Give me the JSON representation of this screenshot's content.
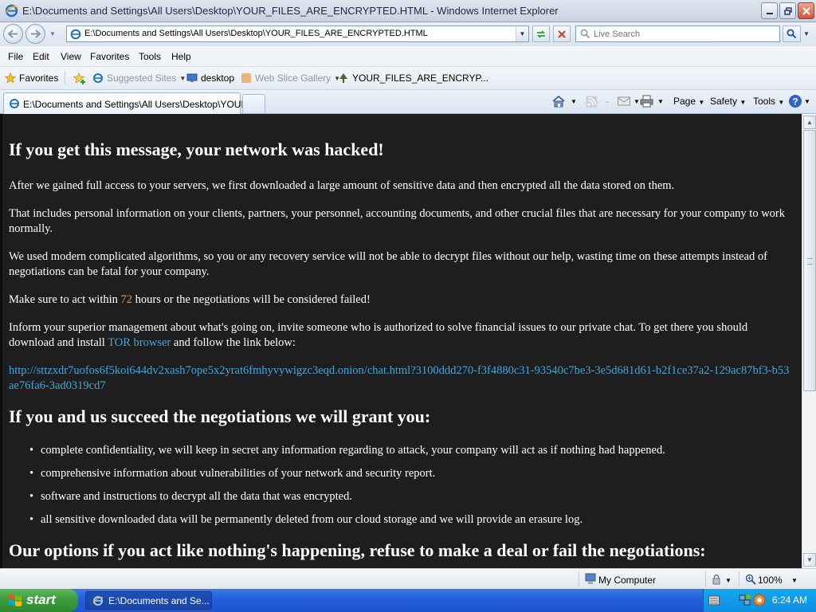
{
  "window": {
    "title": "E:\\Documents and Settings\\All Users\\Desktop\\YOUR_FILES_ARE_ENCRYPTED.HTML - Windows Internet Explorer"
  },
  "address_bar": {
    "url": "E:\\Documents and Settings\\All Users\\Desktop\\YOUR_FILES_ARE_ENCRYPTED.HTML",
    "search_placeholder": "Live Search"
  },
  "menu": {
    "items": [
      "File",
      "Edit",
      "View",
      "Favorites",
      "Tools",
      "Help"
    ]
  },
  "favorites_bar": {
    "favorites_label": "Favorites",
    "items": [
      "Suggested Sites",
      "desktop",
      "Web Slice Gallery",
      "YOUR_FILES_ARE_ENCRYP..."
    ]
  },
  "tabs": {
    "active_label": "E:\\Documents and Settings\\All Users\\Desktop\\YOUR_..."
  },
  "command_bar": {
    "page_label": "Page",
    "safety_label": "Safety",
    "tools_label": "Tools"
  },
  "content": {
    "heading1": "If you get this message, your network was hacked!",
    "p1": "After we gained full access to your servers, we first downloaded a large amount of sensitive data and then encrypted all the data stored on them.",
    "p2": "That includes personal information on your clients, partners, your personnel, accounting documents, and other crucial files that are necessary for your company to work normally.",
    "p3": "We used modern complicated algorithms, so you or any recovery service will not be able to decrypt files without our help, wasting time on these attempts instead of negotiations can be fatal for your company.",
    "p4_before": "Make sure to act within ",
    "p4_hours": "72",
    "p4_after": " hours or the negotiations will be considered failed!",
    "p5_before": "Inform your superior management about what's going on, invite someone who is authorized to solve financial issues to our private chat. To get there you should download and install ",
    "p5_link": "TOR browser",
    "p5_after": " and follow the link below:",
    "onion_link": "http://sttzxdr7uofos6f5koi644dv2xash7ope5x2yrat6fmhyvywigzc3eqd.onion/chat.html?3100ddd270-f3f4880c31-93540c7be3-3e5d681d61-b2f1ce37a2-129ac87bf3-b53ae76fa6-3ad0319cd7",
    "heading2": "If you and us succeed the negotiations we will grant you:",
    "bullets": [
      "complete confidentiality, we will keep in secret any information regarding to attack, your company will act as if nothing had happened.",
      "comprehensive information about vulnerabilities of your network and security report.",
      "software and instructions to decrypt all the data that was encrypted.",
      "all sensitive downloaded data will be permanently deleted from our cloud storage and we will provide an erasure log."
    ],
    "heading3": "Our options if you act like nothing's happening, refuse to make a deal or fail the negotiations:"
  },
  "status_bar": {
    "zone": "My Computer",
    "zoom": "100%"
  },
  "taskbar": {
    "start_label": "start",
    "task_label": "E:\\Documents and Se...",
    "clock": "6:24 AM"
  },
  "colors": {
    "page_background": "#1e1e1e",
    "page_text": "#ffffff",
    "accent_number": "#d4a24c",
    "link": "#45a5d9",
    "taskbar_blue": "#245ddb",
    "start_green": "#3c9a3c"
  }
}
